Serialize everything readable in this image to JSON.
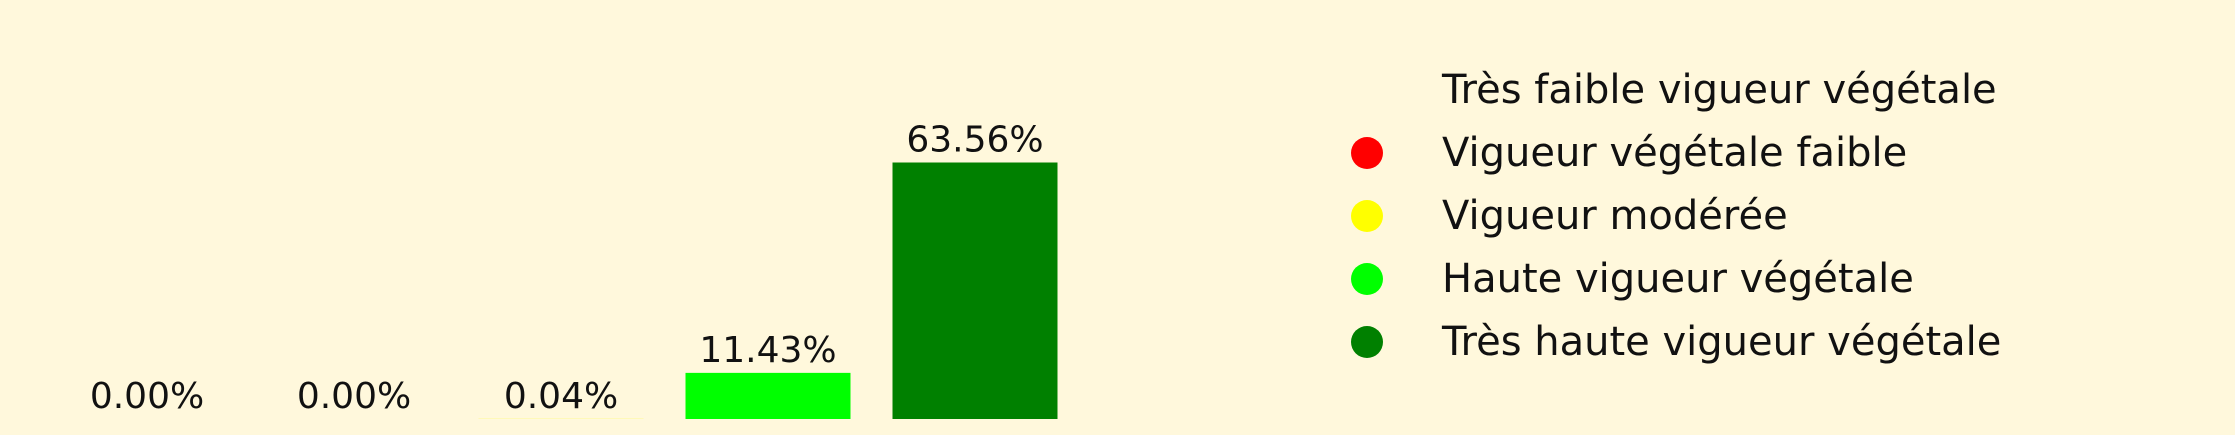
{
  "chart_data": {
    "type": "bar",
    "categories": [
      "Très faible vigueur végétale",
      "Vigueur végétale faible",
      "Vigueur modérée",
      "Haute vigueur végétale",
      "Très haute vigueur végétale"
    ],
    "values": [
      0.0,
      0.0,
      0.04,
      11.43,
      63.56
    ],
    "value_labels": [
      "0.00%",
      "0.00%",
      "0.04%",
      "11.43%",
      "63.56%"
    ],
    "colors": [
      "#fff8dc",
      "#ff0000",
      "#ffff00",
      "#00ff00",
      "#008000"
    ],
    "ylim": [
      0,
      80
    ],
    "grid": false,
    "legend_position": "right"
  },
  "legend": {
    "items": [
      {
        "label": "Très faible vigueur végétale",
        "color": "#fff8dc"
      },
      {
        "label": "Vigueur végétale faible",
        "color": "#ff0000"
      },
      {
        "label": "Vigueur modérée",
        "color": "#ffff00"
      },
      {
        "label": "Haute vigueur végétale",
        "color": "#00ff00"
      },
      {
        "label": "Très haute vigueur végétale",
        "color": "#008000"
      }
    ]
  }
}
